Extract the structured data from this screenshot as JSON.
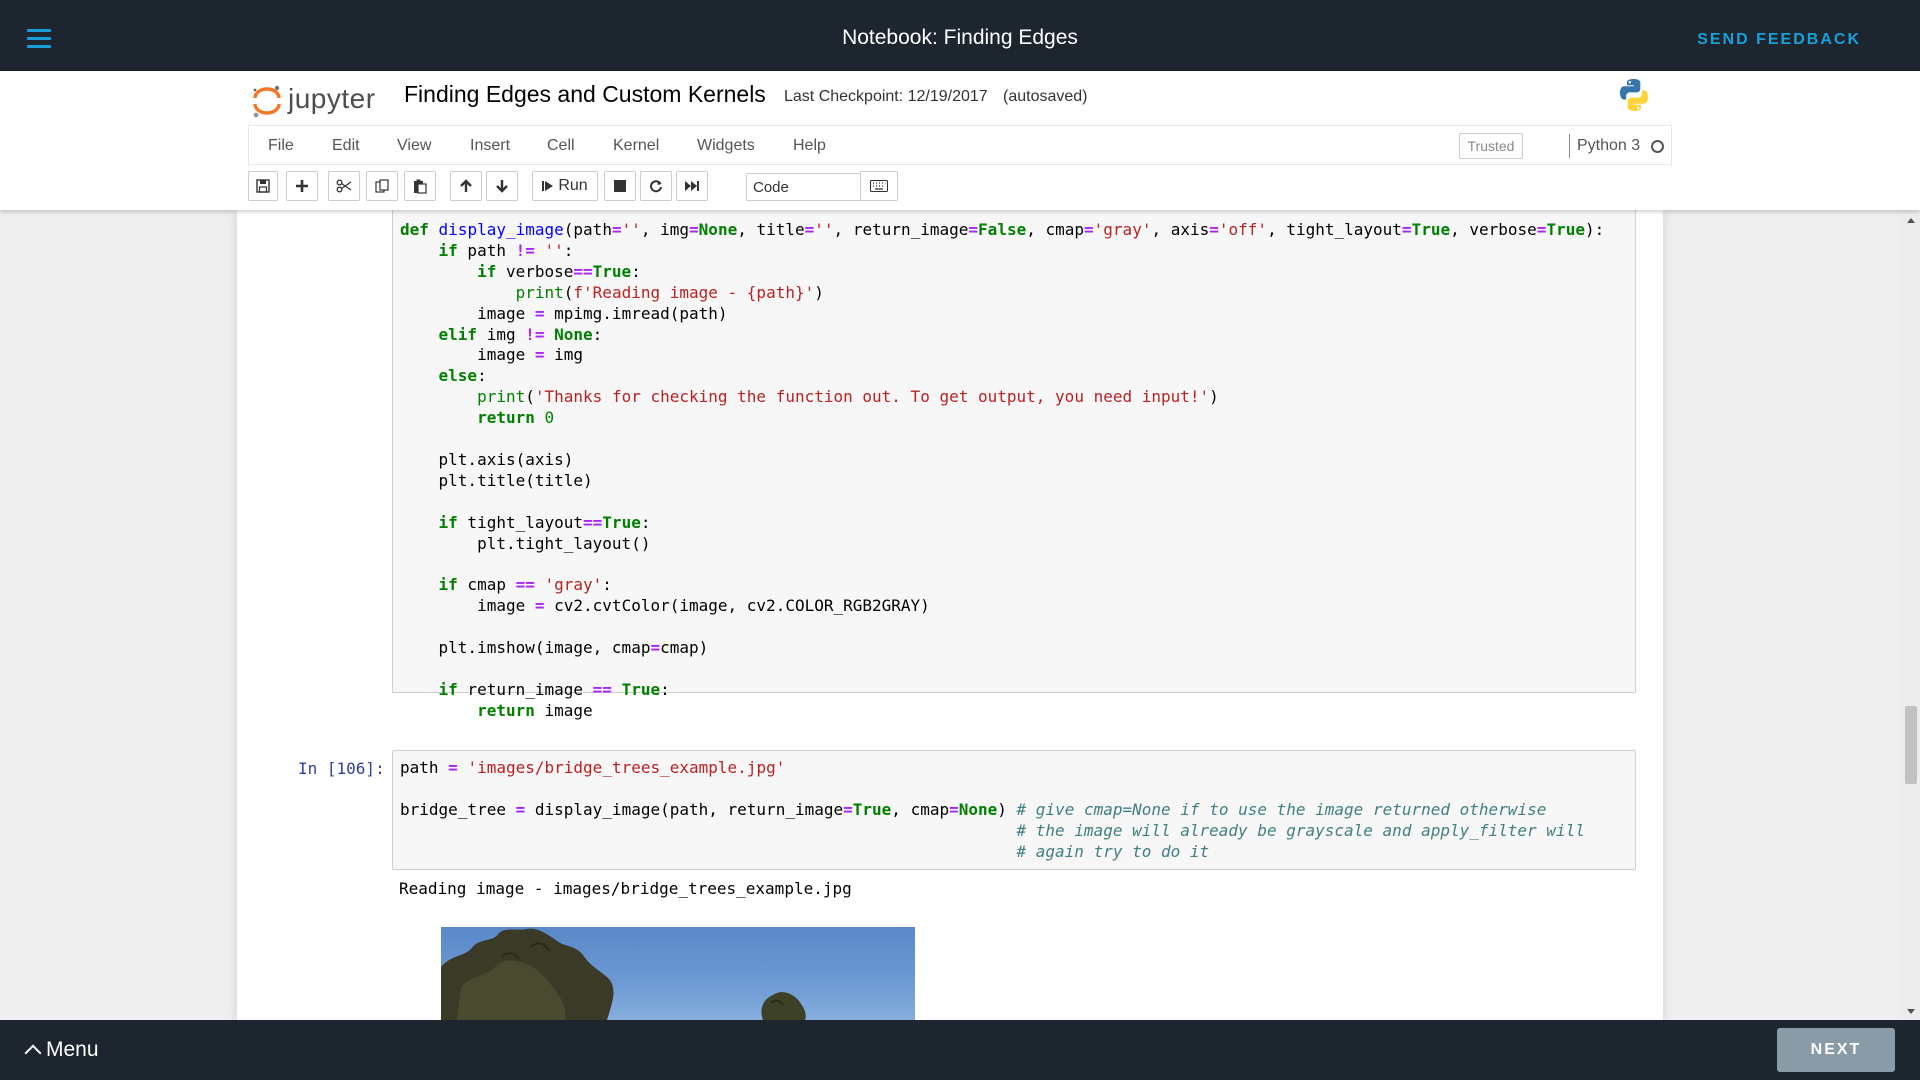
{
  "topbar": {
    "title": "Notebook: Finding Edges",
    "feedback_label": "SEND FEEDBACK"
  },
  "header": {
    "logo_text": "jupyter",
    "notebook_name": "Finding Edges and Custom Kernels",
    "checkpoint": "Last Checkpoint: 12/19/2017",
    "autosave": "(autosaved)"
  },
  "menu": {
    "items": [
      "File",
      "Edit",
      "View",
      "Insert",
      "Cell",
      "Kernel",
      "Widgets",
      "Help"
    ],
    "trusted_label": "Trusted",
    "kernel_name": "Python 3"
  },
  "toolbar": {
    "run_label": "Run",
    "cell_type": "Code",
    "buttons": [
      "save-icon",
      "plus-icon",
      "scissors-icon",
      "copy-icon",
      "paste-icon",
      "arrow-up-icon",
      "arrow-down-icon",
      "run-icon",
      "stop-icon",
      "restart-icon",
      "fast-forward-icon",
      "keyboard-icon"
    ]
  },
  "cells": {
    "cell1": {
      "lines": [
        "def display_image(path='', img=None, title='', return_image=False, cmap='gray', axis='off', tight_layout=True, verbose=True):",
        "    if path != '':",
        "        if verbose==True:",
        "            print(f'Reading image - {path}')",
        "        image = mpimg.imread(path)",
        "    elif img != None:",
        "        image = img",
        "    else:",
        "        print('Thanks for checking the function out. To get output, you need input!')",
        "        return 0",
        "",
        "    plt.axis(axis)",
        "    plt.title(title)",
        "",
        "    if tight_layout==True:",
        "        plt.tight_layout()",
        "",
        "    if cmap == 'gray':",
        "        image = cv2.cvtColor(image, cv2.COLOR_RGB2GRAY)",
        "",
        "    plt.imshow(image, cmap=cmap)",
        "",
        "    if return_image == True:",
        "        return image"
      ]
    },
    "cell2": {
      "prompt": "In [106]:",
      "lines": [
        "path = 'images/bridge_trees_example.jpg'",
        "",
        "bridge_tree = display_image(path, return_image=True, cmap=None) # give cmap=None if to use the image returned otherwise",
        "                                                                # the image will already be grayscale and apply_filter will",
        "                                                                # again try to do it"
      ],
      "output": "Reading image - images/bridge_trees_example.jpg"
    }
  },
  "bottombar": {
    "menu_label": "Menu",
    "next_label": "NEXT"
  },
  "colors": {
    "dark_bar": "#1d252e",
    "accent": "#18a0d8",
    "keyword": "#008000",
    "string": "#ba2121",
    "operator": "#aa22ff",
    "comment": "#408080",
    "prompt": "#303f9f"
  }
}
